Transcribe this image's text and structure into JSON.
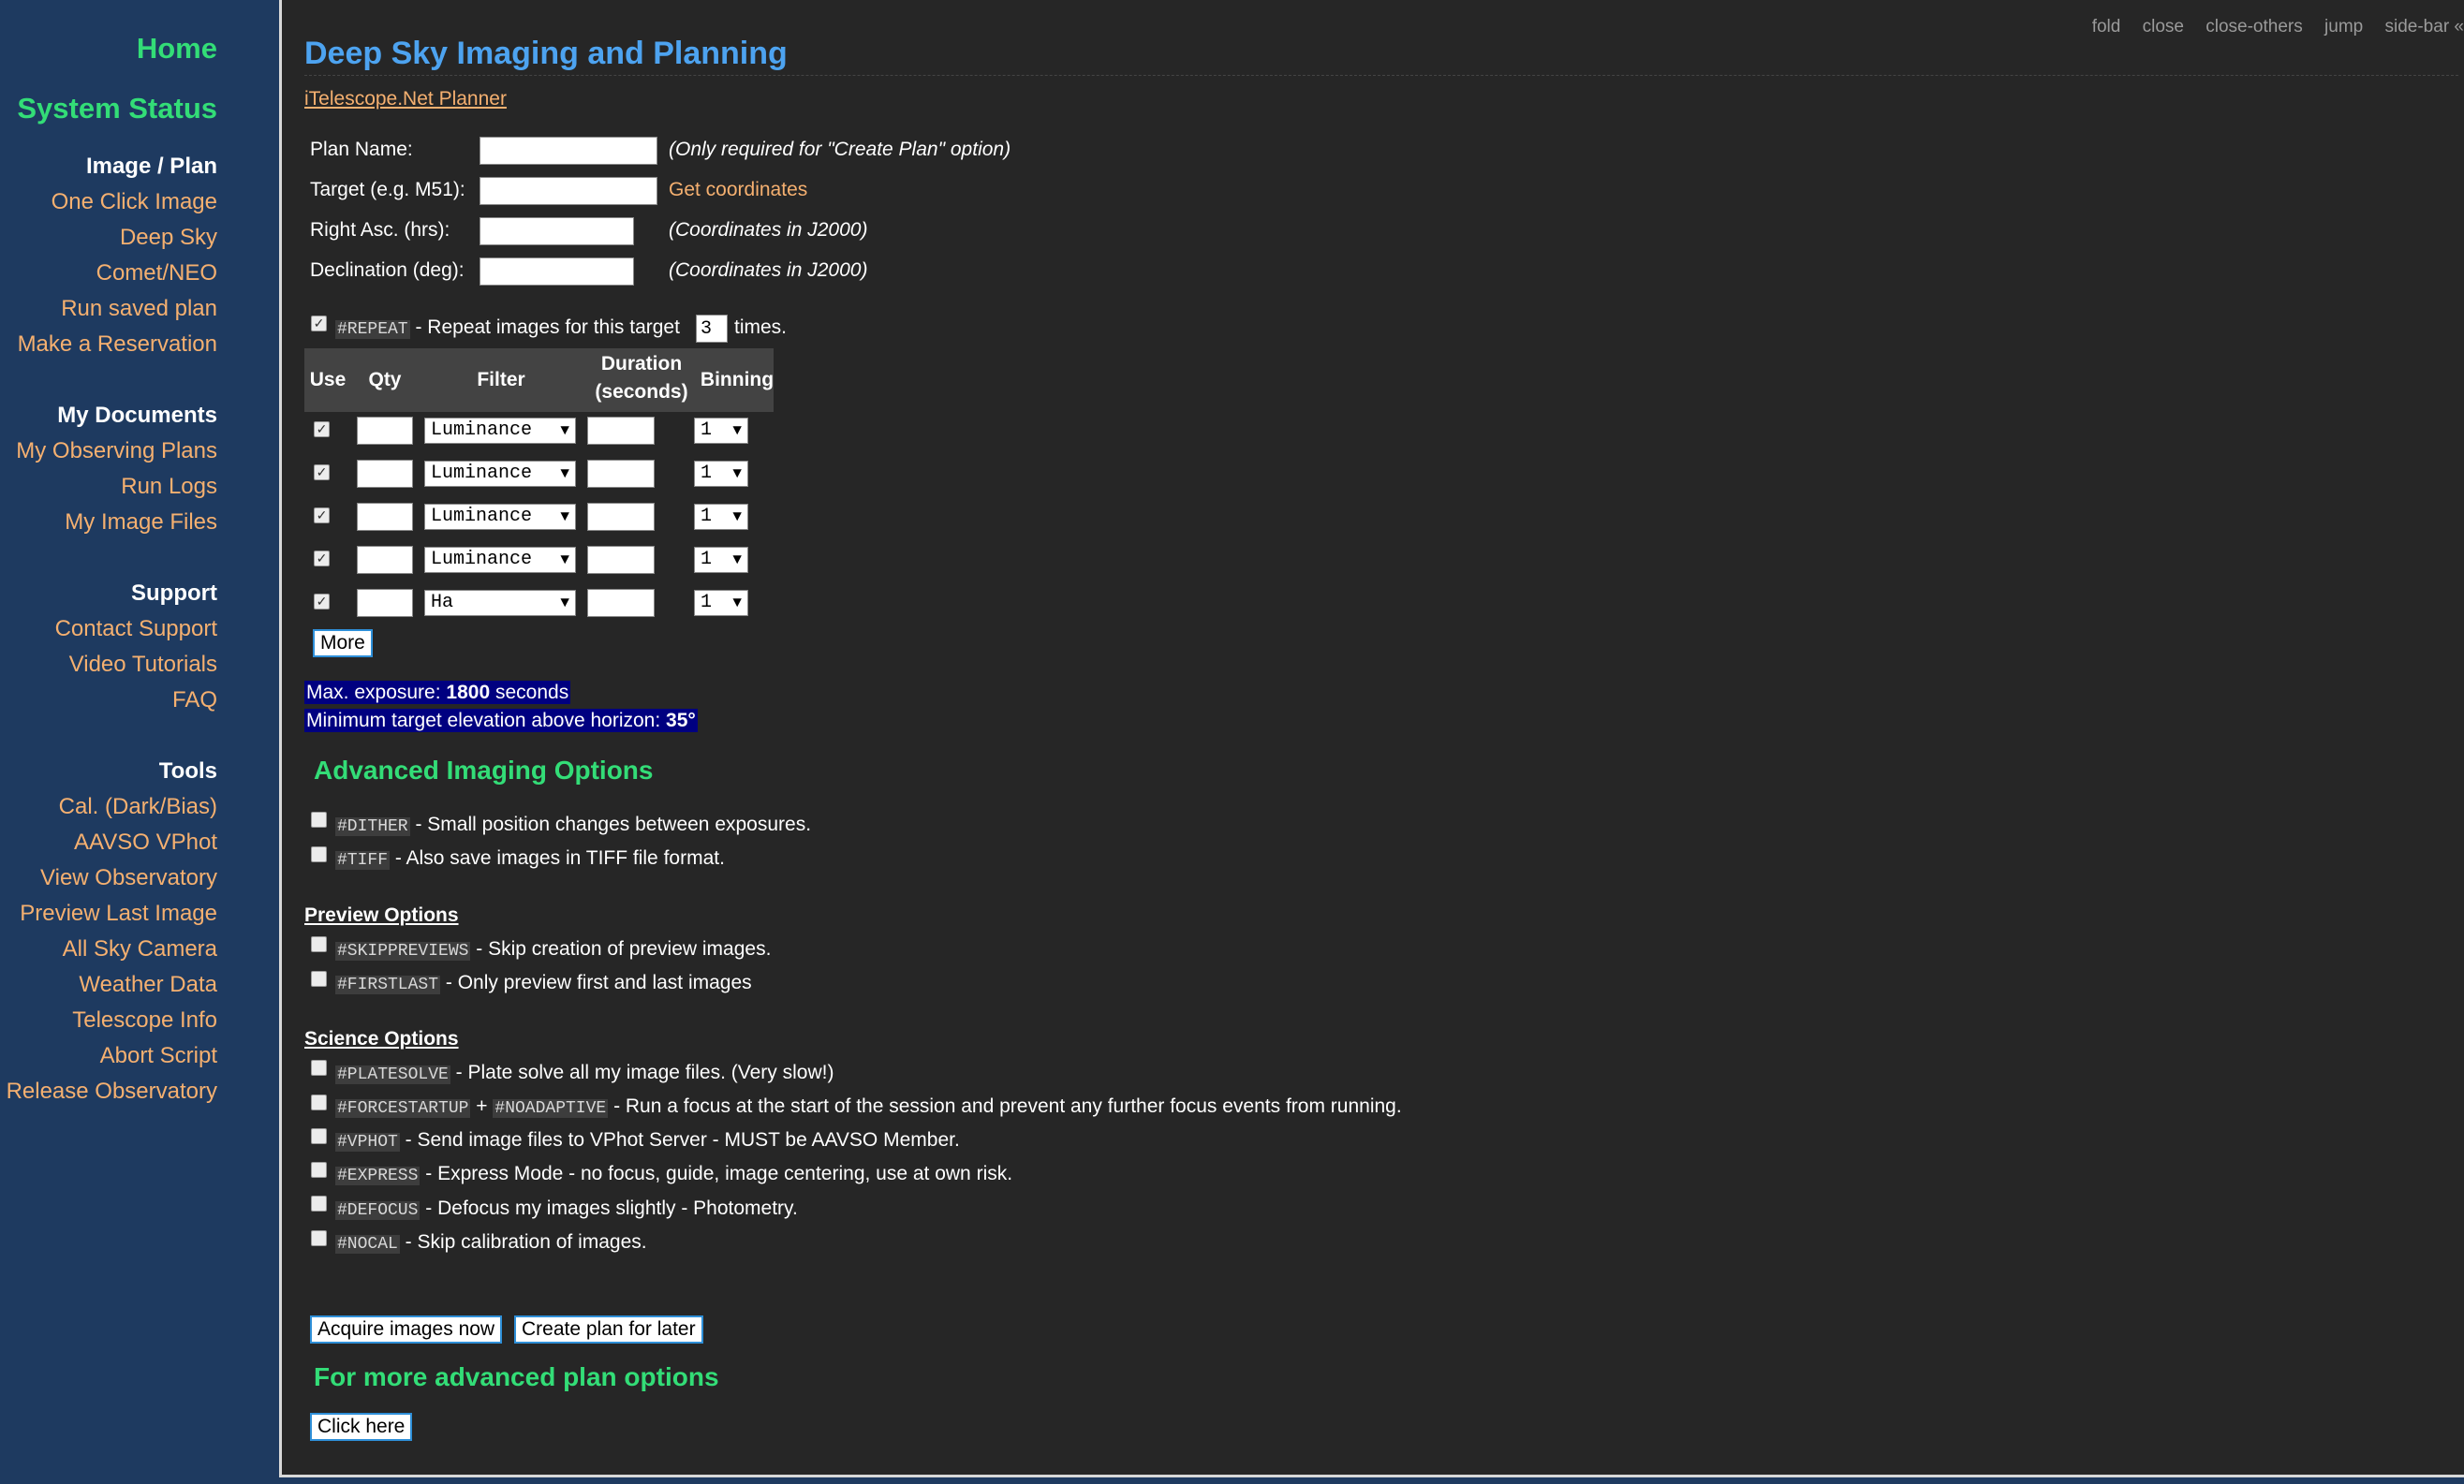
{
  "sidebar": {
    "home": "Home",
    "system_status": "System Status",
    "image_plan": {
      "heading": "Image / Plan",
      "items": [
        "One Click Image",
        "Deep Sky",
        "Comet/NEO",
        "Run saved plan",
        "Make a Reservation"
      ]
    },
    "my_documents": {
      "heading": "My Documents",
      "items": [
        "My Observing Plans",
        "Run Logs",
        "My Image Files"
      ]
    },
    "support": {
      "heading": "Support",
      "items": [
        "Contact Support",
        "Video Tutorials",
        "FAQ"
      ]
    },
    "tools": {
      "heading": "Tools",
      "items": [
        "Cal. (Dark/Bias)",
        "AAVSO VPhot",
        "View Observatory",
        "Preview Last Image",
        "All Sky Camera",
        "Weather Data",
        "Telescope Info",
        "Abort Script",
        "Release Observatory"
      ]
    }
  },
  "topbar": [
    "fold",
    "close",
    "close-others",
    "jump",
    "side-bar «"
  ],
  "page": {
    "title": "Deep Sky Imaging and Planning",
    "planner_link": "iTelescope.Net Planner"
  },
  "form": {
    "plan_name": {
      "label": "Plan Name:",
      "value": "",
      "note": "(Only required for \"Create Plan\" option)"
    },
    "target": {
      "label": "Target (e.g. M51):",
      "value": "",
      "link": "Get coordinates"
    },
    "ra": {
      "label": "Right Asc. (hrs):",
      "value": "",
      "note": "(Coordinates in J2000)"
    },
    "dec": {
      "label": "Declination (deg):",
      "value": "",
      "note": "(Coordinates in J2000)"
    }
  },
  "repeat": {
    "code": "#REPEAT",
    "text_before": "- Repeat images for this target",
    "count": "3",
    "text_after": "times.",
    "checked": true
  },
  "filter_table": {
    "headers": {
      "use": "Use",
      "qty": "Qty",
      "filter": "Filter",
      "duration_1": "Duration",
      "duration_2": "(seconds)",
      "binning": "Binning"
    },
    "rows": [
      {
        "use": true,
        "qty": "",
        "filter": "Luminance",
        "duration": "",
        "binning": "1"
      },
      {
        "use": true,
        "qty": "",
        "filter": "Luminance",
        "duration": "",
        "binning": "1"
      },
      {
        "use": true,
        "qty": "",
        "filter": "Luminance",
        "duration": "",
        "binning": "1"
      },
      {
        "use": true,
        "qty": "",
        "filter": "Luminance",
        "duration": "",
        "binning": "1"
      },
      {
        "use": true,
        "qty": "",
        "filter": "Ha",
        "duration": "",
        "binning": "1"
      }
    ],
    "more_button": "More"
  },
  "limits": {
    "max_exposure_prefix": "Max. exposure:",
    "max_exposure_value": "1800",
    "max_exposure_suffix": "seconds",
    "min_elev_prefix": "Minimum target elevation above horizon:",
    "min_elev_value": "35°"
  },
  "advanced": {
    "heading": "Advanced Imaging Options",
    "options": [
      {
        "code": "#DITHER",
        "text": "- Small position changes between exposures."
      },
      {
        "code": "#TIFF",
        "text": "- Also save images in TIFF file format."
      }
    ]
  },
  "preview": {
    "heading": "Preview Options",
    "options": [
      {
        "code": "#SKIPPREVIEWS",
        "text": "- Skip creation of preview images."
      },
      {
        "code": "#FIRSTLAST",
        "text": "- Only preview first and last images"
      }
    ]
  },
  "science": {
    "heading": "Science Options",
    "options": [
      {
        "code": "#PLATESOLVE",
        "text": "- Plate solve all my image files. (Very slow!)"
      },
      {
        "code": "#FORCESTARTUP",
        "plus": "+",
        "code2": "#NOADAPTIVE",
        "text": "- Run a focus at the start of the session and prevent any further focus events from running."
      },
      {
        "code": "#VPHOT",
        "text": "- Send image files to VPhot Server - MUST be AAVSO Member."
      },
      {
        "code": "#EXPRESS",
        "text": "- Express Mode - no focus, guide, image centering, use at own risk."
      },
      {
        "code": "#DEFOCUS",
        "text": "- Defocus my images slightly - Photometry."
      },
      {
        "code": "#NOCAL",
        "text": "- Skip calibration of images."
      }
    ]
  },
  "actions": {
    "acquire": "Acquire images now",
    "create_plan": "Create plan for later",
    "more_heading": "For more advanced plan options",
    "click_here": "Click here"
  }
}
